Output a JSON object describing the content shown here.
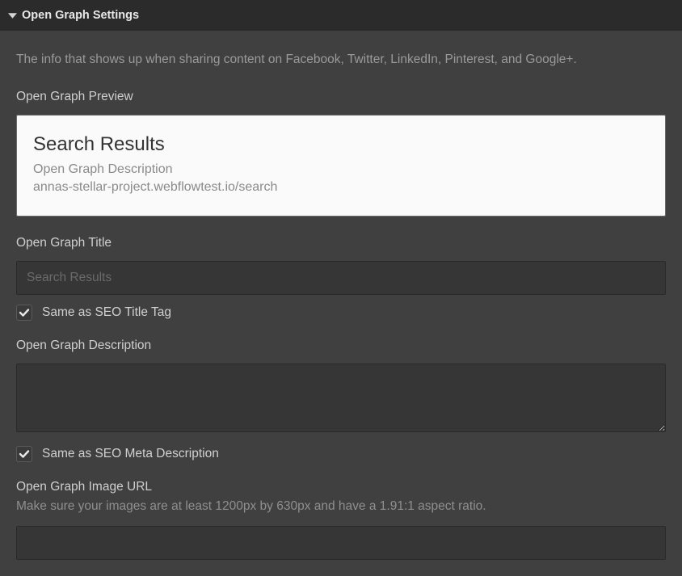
{
  "header": {
    "title": "Open Graph Settings"
  },
  "intro": "The info that shows up when sharing content on Facebook, Twitter, LinkedIn, Pinterest, and Google+.",
  "preview": {
    "label": "Open Graph Preview",
    "title": "Search Results",
    "description": "Open Graph Description",
    "url": "annas-stellar-project.webflowtest.io/search"
  },
  "ogTitle": {
    "label": "Open Graph Title",
    "placeholder": "Search Results",
    "value": "",
    "checkboxLabel": "Same as SEO Title Tag"
  },
  "ogDescription": {
    "label": "Open Graph Description",
    "value": "",
    "checkboxLabel": "Same as SEO Meta Description"
  },
  "ogImage": {
    "label": "Open Graph Image URL",
    "help": "Make sure your images are at least 1200px by 630px and have a 1.91:1 aspect ratio.",
    "value": ""
  }
}
